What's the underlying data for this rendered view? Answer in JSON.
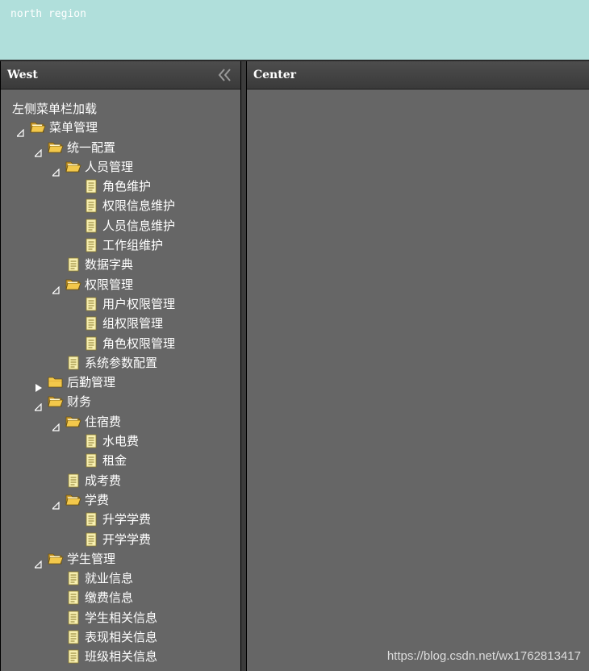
{
  "north": {
    "text": "north region"
  },
  "west": {
    "title": "West"
  },
  "center": {
    "title": "Center"
  },
  "tree_root": "左侧菜单栏加载",
  "tree": [
    {
      "label": "菜单管理",
      "depth": 0,
      "type": "folder",
      "state": "open"
    },
    {
      "label": "统一配置",
      "depth": 1,
      "type": "folder",
      "state": "open"
    },
    {
      "label": "人员管理",
      "depth": 2,
      "type": "folder",
      "state": "open"
    },
    {
      "label": "角色维护",
      "depth": 3,
      "type": "file"
    },
    {
      "label": "权限信息维护",
      "depth": 3,
      "type": "file"
    },
    {
      "label": "人员信息维护",
      "depth": 3,
      "type": "file"
    },
    {
      "label": "工作组维护",
      "depth": 3,
      "type": "file"
    },
    {
      "label": "数据字典",
      "depth": 2,
      "type": "file"
    },
    {
      "label": "权限管理",
      "depth": 2,
      "type": "folder",
      "state": "open"
    },
    {
      "label": "用户权限管理",
      "depth": 3,
      "type": "file"
    },
    {
      "label": "组权限管理",
      "depth": 3,
      "type": "file"
    },
    {
      "label": "角色权限管理",
      "depth": 3,
      "type": "file"
    },
    {
      "label": "系统参数配置",
      "depth": 2,
      "type": "file"
    },
    {
      "label": "后勤管理",
      "depth": 1,
      "type": "folder",
      "state": "closed"
    },
    {
      "label": "财务",
      "depth": 1,
      "type": "folder",
      "state": "open"
    },
    {
      "label": "住宿费",
      "depth": 2,
      "type": "folder",
      "state": "open"
    },
    {
      "label": "水电费",
      "depth": 3,
      "type": "file"
    },
    {
      "label": "租金",
      "depth": 3,
      "type": "file"
    },
    {
      "label": "成考费",
      "depth": 2,
      "type": "file"
    },
    {
      "label": "学费",
      "depth": 2,
      "type": "folder",
      "state": "open"
    },
    {
      "label": "升学学费",
      "depth": 3,
      "type": "file"
    },
    {
      "label": "开学学费",
      "depth": 3,
      "type": "file"
    },
    {
      "label": "学生管理",
      "depth": 1,
      "type": "folder",
      "state": "open"
    },
    {
      "label": "就业信息",
      "depth": 2,
      "type": "file"
    },
    {
      "label": "缴费信息",
      "depth": 2,
      "type": "file"
    },
    {
      "label": "学生相关信息",
      "depth": 2,
      "type": "file"
    },
    {
      "label": "表现相关信息",
      "depth": 2,
      "type": "file"
    },
    {
      "label": "班级相关信息",
      "depth": 2,
      "type": "file"
    }
  ],
  "icons": {
    "folder_open": "folder-open-icon",
    "folder_closed": "folder-closed-icon",
    "file": "file-icon",
    "expand": "expand-arrow-icon",
    "collapse": "collapse-arrow-icon",
    "collapse_panel": "double-chevron-left-icon"
  },
  "colors": {
    "north_bg": "#b0dfdb",
    "panel_bg": "#666666",
    "header_bg": "#3f3f3f",
    "text": "#ffffff",
    "folder": "#f3c84b"
  },
  "watermark": "https://blog.csdn.net/wx1762813417"
}
